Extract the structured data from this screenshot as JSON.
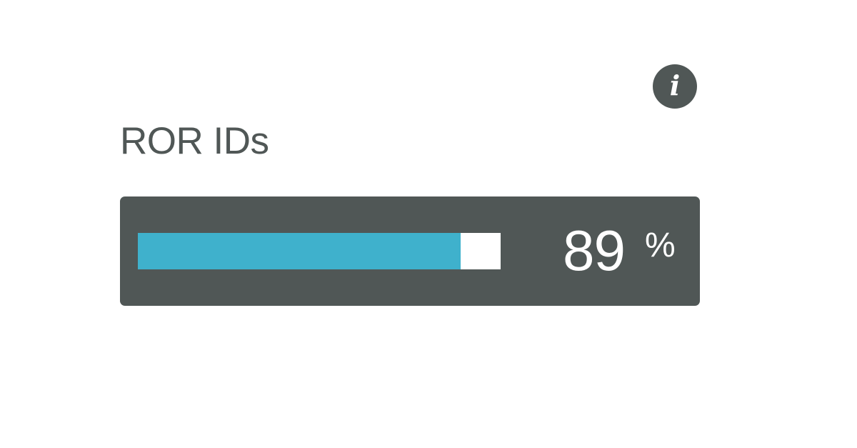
{
  "info": {
    "icon": "info-icon",
    "glyph": "i"
  },
  "metric": {
    "title": "ROR IDs",
    "value": "89",
    "unit": "%",
    "progress_percent": 89
  },
  "colors": {
    "panel_background": "#505756",
    "progress_fill": "#3fb1cc",
    "progress_track": "#ffffff",
    "title_text": "#505756",
    "value_text": "#ffffff"
  }
}
